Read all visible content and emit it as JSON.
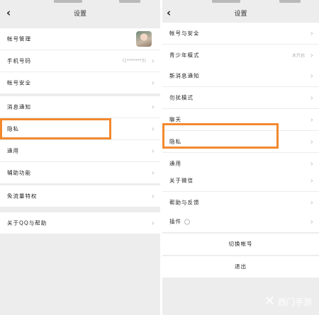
{
  "left": {
    "title": "设置",
    "groups": [
      [
        {
          "label": "帐号管理",
          "kind": "avatar"
        },
        {
          "label": "手机号码",
          "value": "(1*******3)",
          "kind": "value"
        },
        {
          "label": "帐号安全"
        }
      ],
      [
        {
          "label": "消息通知"
        },
        {
          "label": "隐私"
        },
        {
          "label": "通用"
        },
        {
          "label": "辅助功能"
        }
      ],
      [
        {
          "label": "免流量特权"
        }
      ],
      [
        {
          "label": "关于QQ与帮助"
        }
      ]
    ]
  },
  "right": {
    "title": "设置",
    "groups": [
      [
        {
          "label": "帐号与安全"
        },
        {
          "label": "青少年模式",
          "value": "未开启",
          "kind": "value"
        }
      ],
      [
        {
          "label": "新消息通知"
        },
        {
          "label": "勿扰模式"
        },
        {
          "label": "聊天"
        },
        {
          "label": "隐私"
        },
        {
          "label": "通用"
        }
      ],
      [
        {
          "label": "关于微信"
        },
        {
          "label": "帮助与反馈"
        }
      ],
      [
        {
          "label": "插件",
          "kind": "icon"
        }
      ]
    ],
    "switch_account": "切换帐号",
    "logout": "退出"
  },
  "watermark": "西门手游",
  "colors": {
    "highlight": "#f2892f",
    "background": "#ededed",
    "card": "#ffffff"
  }
}
